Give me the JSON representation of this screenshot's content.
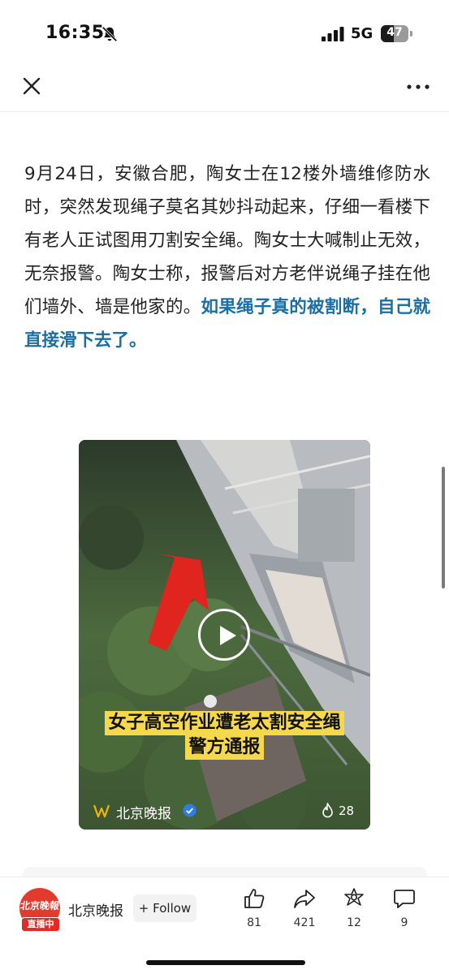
{
  "status_bar": {
    "time": "16:35",
    "network": "5G",
    "battery_percent": 47,
    "battery_label": "47"
  },
  "nav": {
    "close_icon": "close-icon",
    "more_icon": "more-icon"
  },
  "article": {
    "body": "9月24日，安徽合肥，陶女士在12楼外墙维修防水时，突然发现绳子莫名其妙抖动起来，仔细一看楼下有老人正试图用刀割安全绳。陶女士大喊制止无效，无奈报警。陶女士称，报警后对方老伴说绳子挂在他们墙外、墙是他家的。",
    "highlight": "如果绳子真的被割断，自己就直接滑下去了。",
    "highlight_color": "#1a6fa5"
  },
  "video": {
    "caption_line1": "女子高空作业遭老太割安全绳",
    "caption_line2": "警方通报",
    "caption_bg": "#f6d94a",
    "source_name": "北京晚报",
    "heat_count": "28"
  },
  "bottom_bar": {
    "avatar_text": "北京晚報",
    "live_badge": "直播中",
    "account_name": "北京晚报",
    "follow_label": "+ Follow",
    "actions": [
      {
        "icon": "thumbs-up-icon",
        "count": "81"
      },
      {
        "icon": "share-icon",
        "count": "421"
      },
      {
        "icon": "gem-icon",
        "count": "12"
      },
      {
        "icon": "comment-icon",
        "count": "9"
      }
    ]
  },
  "colors": {
    "brand_red": "#e23b2e"
  }
}
